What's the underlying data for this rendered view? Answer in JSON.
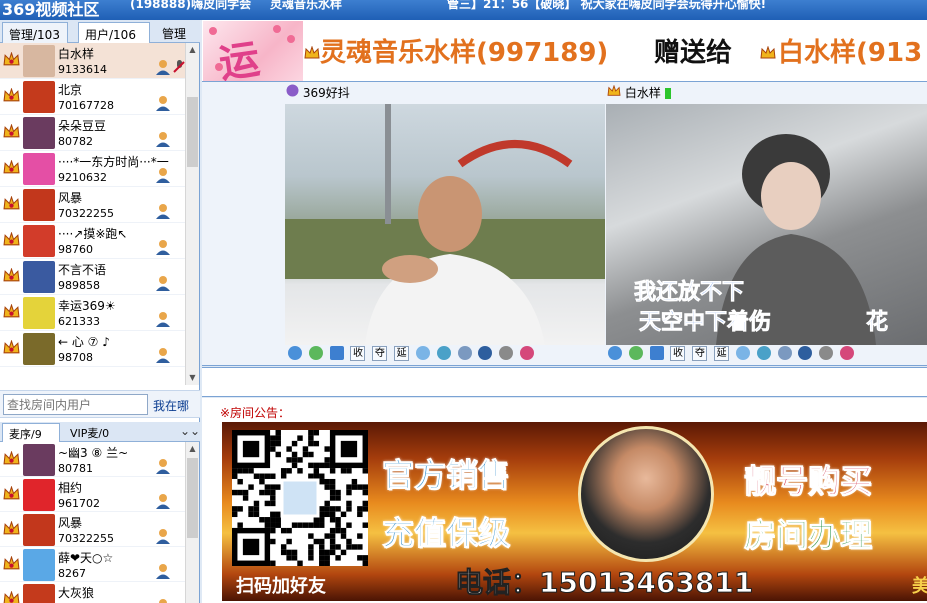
{
  "titlebar": {
    "brand": "369视频社区",
    "item2": "(198888)嗨皮同学会",
    "item3": "灵魂音乐水样",
    "item4": "管三】21：56【破晓】 祝大家在嗨皮同学会玩得开心愉快!"
  },
  "tabs": {
    "admins": "管理/103",
    "users": "用户/106",
    "manage": "管理"
  },
  "users": [
    {
      "name": "白水样",
      "id": "9133614",
      "avatar": "#d7b7a0",
      "selected": true,
      "mic": true
    },
    {
      "name": "北京",
      "id": "70167728",
      "avatar": "#c43a1c"
    },
    {
      "name": "朵朵豆豆",
      "id": "80782",
      "avatar": "#6a3b5f"
    },
    {
      "name": "····*一东方时尚···*一",
      "id": "9210632",
      "avatar": "#e44fa5"
    },
    {
      "name": "风暴",
      "id": "70322255",
      "avatar": "#c2371c"
    },
    {
      "name": "····↗摸※跑↖",
      "id": "98760",
      "avatar": "#d23c2a"
    },
    {
      "name": "不言不语",
      "id": "989858",
      "avatar": "#3a5aa0"
    },
    {
      "name": "幸运369☀",
      "id": "621333",
      "avatar": "#e4d33a"
    },
    {
      "name": "← 心 ⑦ ♪",
      "id": "98708",
      "avatar": "#7a6a2a"
    }
  ],
  "search": {
    "placeholder": "查找房间内用户",
    "button": "我在哪"
  },
  "queue_tabs": {
    "mic_queue": "麦序/9",
    "vip_queue": "VIP麦/0"
  },
  "queue": [
    {
      "name": "~幽3 ⑧ 兰~",
      "id": "80781",
      "avatar": "#6a3b5f"
    },
    {
      "name": "相约",
      "id": "961702",
      "avatar": "#e0252b"
    },
    {
      "name": "风暴",
      "id": "70322255",
      "avatar": "#c2371c"
    },
    {
      "name": "薛❤天○☆",
      "id": "8267",
      "avatar": "#5aa8e6"
    },
    {
      "name": "大灰狼",
      "id": "",
      "avatar": "#c43a1c"
    }
  ],
  "banner": {
    "sender": "灵魂音乐水样(997189)",
    "action": "赠送给",
    "receiver": "白水样(913"
  },
  "video": {
    "left_label": "369好抖",
    "right_label": "白水样",
    "lyric_line1": "我还放不下",
    "lyric_line2": "天空中下着伤",
    "lyric_tail": "花",
    "controls": [
      "收",
      "夺",
      "延"
    ]
  },
  "notice": {
    "title": "※房间公告：",
    "ad_official": "官方销售",
    "ad_recharge": "充值保级",
    "ad_number": "靓号购买",
    "ad_room": "房间办理",
    "ad_phone": "电话：15013463811",
    "ad_qr_label": "扫码加好友",
    "ad_cut": "美"
  },
  "colors": {
    "accent": "#1f5fb5",
    "banner_orange": "#e2711e",
    "notice_red": "#c00000"
  }
}
